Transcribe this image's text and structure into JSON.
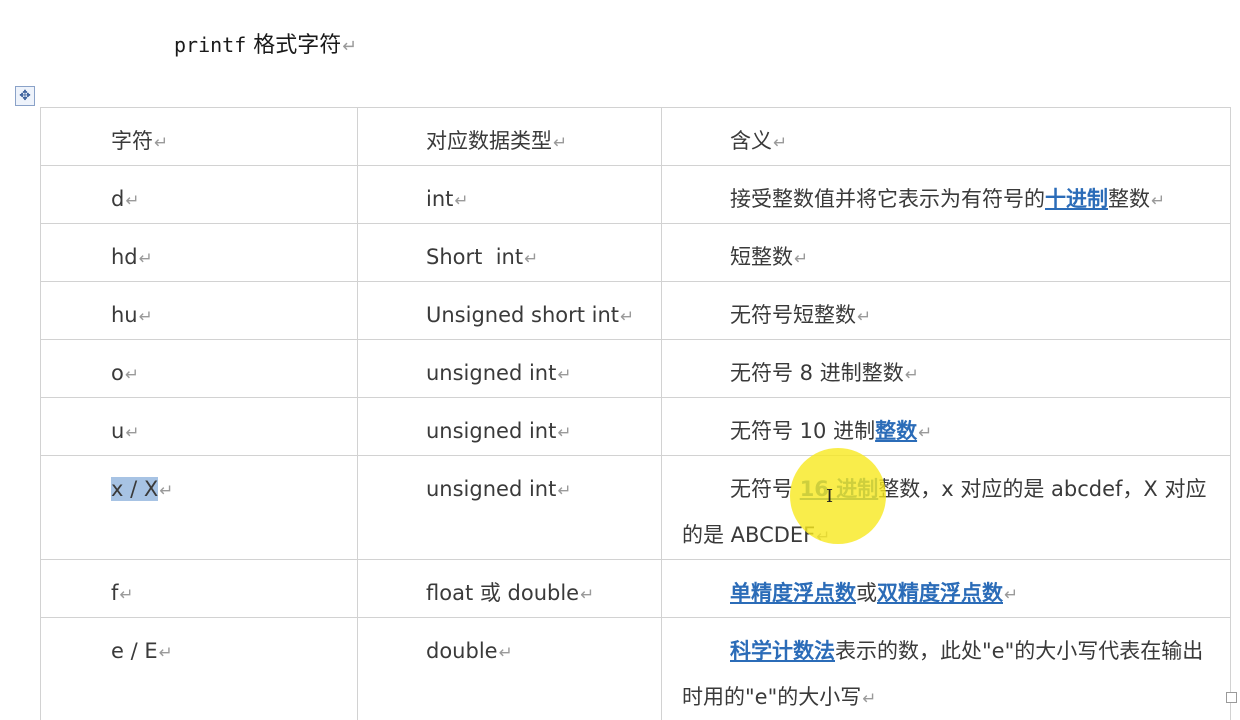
{
  "document": {
    "title_code": "printf",
    "title_text": "格式字符",
    "paragraph_mark": "↵",
    "move_handle_glyph": "✥"
  },
  "table": {
    "headers": [
      "字符",
      "对应数据类型",
      "含义"
    ],
    "rows": [
      {
        "fmt": "d",
        "type": "int",
        "desc_parts": [
          {
            "text": "接受整数值并将它表示为有符号的",
            "link": false
          },
          {
            "text": "十进制",
            "link": true
          },
          {
            "text": "整数",
            "link": false
          }
        ]
      },
      {
        "fmt": "hd",
        "type": "Short  int",
        "desc_parts": [
          {
            "text": "短整数",
            "link": false
          }
        ]
      },
      {
        "fmt": "hu",
        "type": "Unsigned short int",
        "desc_parts": [
          {
            "text": "无符号短整数",
            "link": false
          }
        ]
      },
      {
        "fmt": "o",
        "type": "unsigned int",
        "desc_parts": [
          {
            "text": "无符号 8 进制整数",
            "link": false
          }
        ]
      },
      {
        "fmt": "u",
        "type": "unsigned int",
        "desc_parts": [
          {
            "text": "无符号 10 进制",
            "link": false
          },
          {
            "text": "整数",
            "link": true
          }
        ]
      },
      {
        "fmt": "x / X",
        "fmt_selected": true,
        "type": "unsigned int",
        "desc_parts": [
          {
            "text": "无符号 ",
            "link": false
          },
          {
            "text": "16 进制",
            "link": true
          },
          {
            "text": "整数，x 对应的是 abcdef，X 对应的是 ABCDEF",
            "link": false
          }
        ]
      },
      {
        "fmt": "f",
        "type": "float 或 double",
        "desc_parts": [
          {
            "text": "单精度浮点数",
            "link": true
          },
          {
            "text": "或",
            "link": false
          },
          {
            "text": "双精度浮点数",
            "link": true
          }
        ]
      },
      {
        "fmt": "e / E",
        "type": "double",
        "desc_parts": [
          {
            "text": "科学计数法",
            "link": true
          },
          {
            "text": "表示的数，此处\"e\"的大小写代表在输出时用的\"e\"的大小写",
            "link": false
          }
        ]
      }
    ]
  },
  "colors": {
    "link": "#2b6cb8",
    "selection": "#a7c3e4",
    "cursor_highlight": "#f8e81e",
    "grid": "#d2d2d2",
    "text": "#3a3a3a"
  }
}
